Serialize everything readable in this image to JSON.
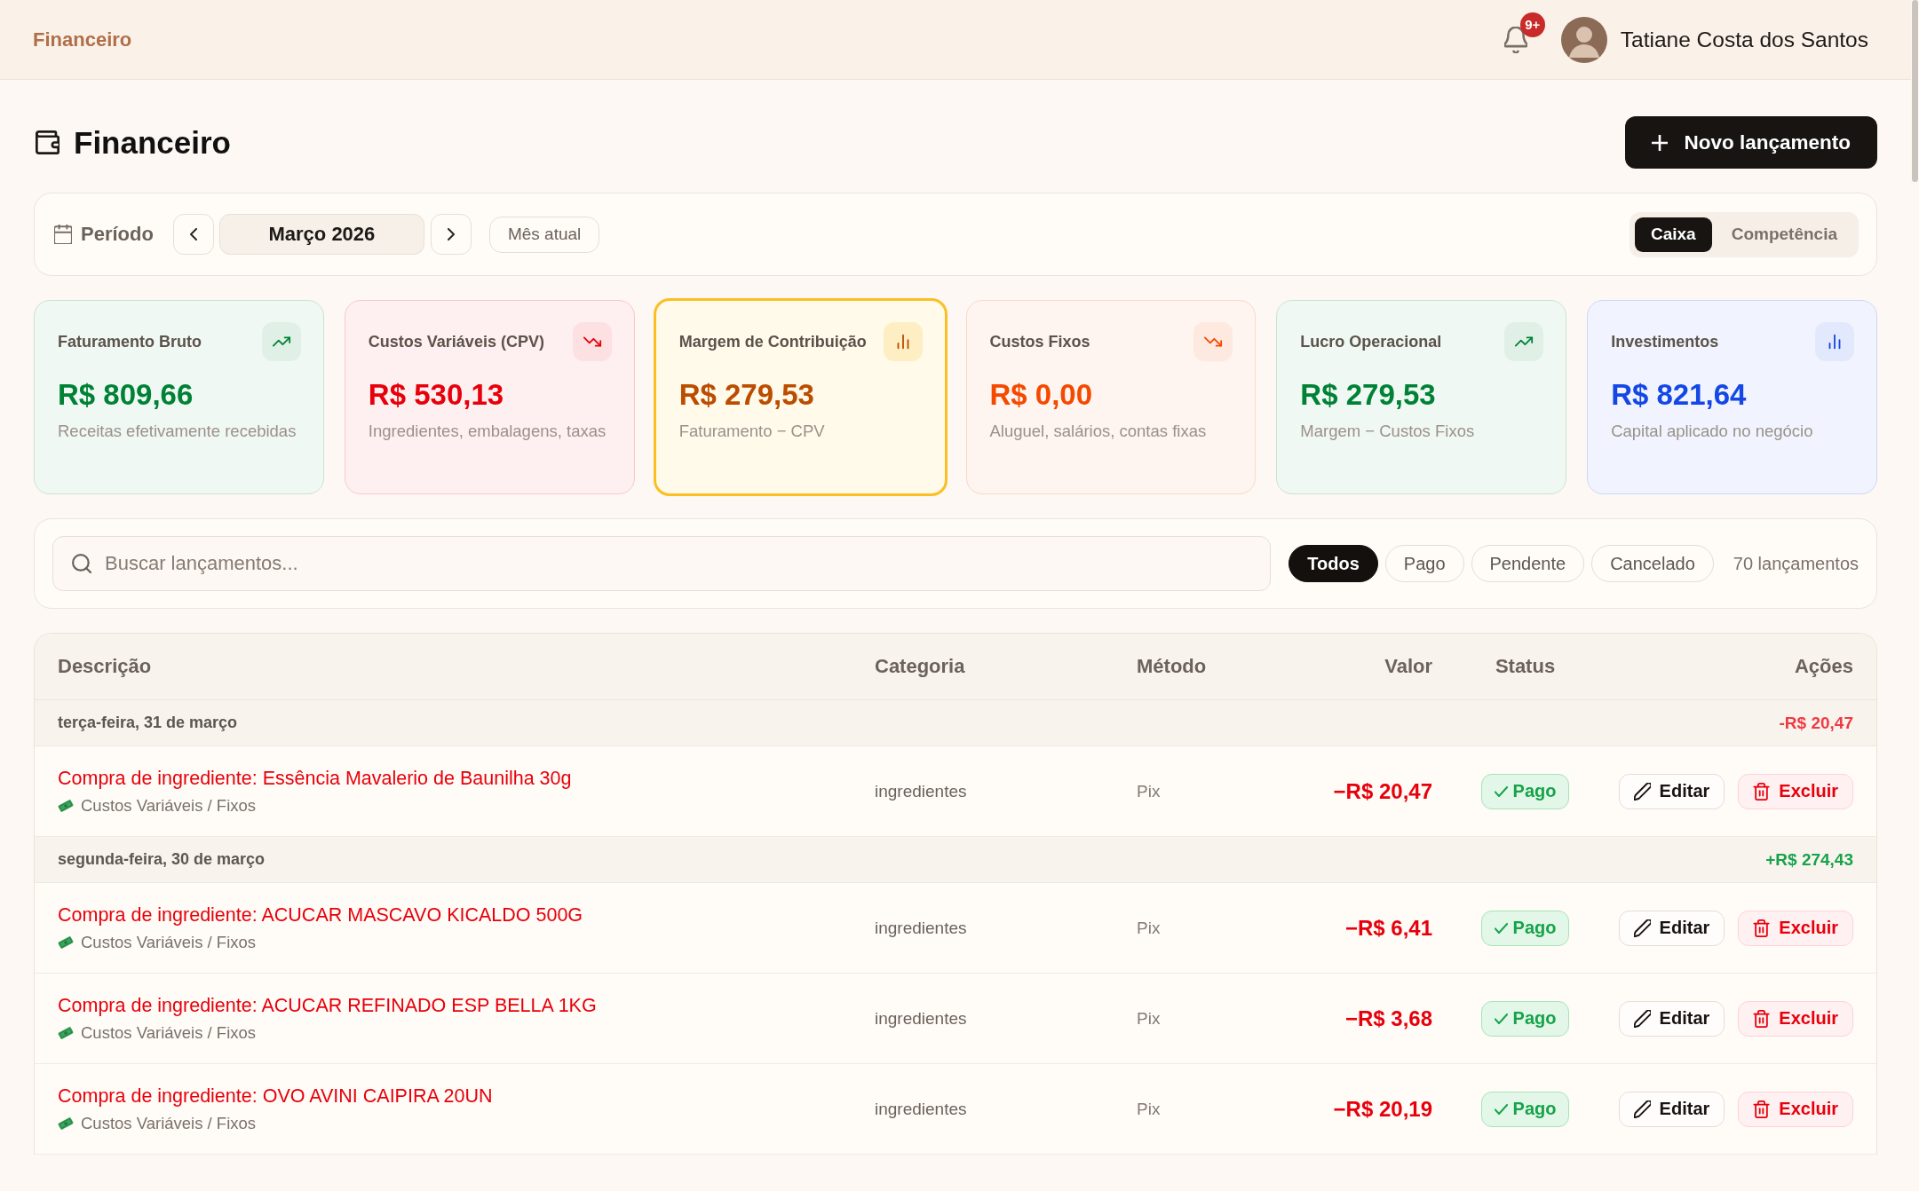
{
  "topbar": {
    "title": "Financeiro",
    "notification_badge": "9+",
    "user_name": "Tatiane Costa dos Santos"
  },
  "header": {
    "title": "Financeiro",
    "new_entry_button": "Novo lançamento"
  },
  "period": {
    "label": "Período",
    "month": "Março 2026",
    "current_month_button": "Mês atual",
    "modes": [
      {
        "label": "Caixa",
        "selected": true
      },
      {
        "label": "Competência",
        "selected": false
      }
    ]
  },
  "summary_cards": [
    {
      "title": "Faturamento Bruto",
      "value": "R$ 809,66",
      "note": "Receitas efetivamente recebidas",
      "kind": "rising",
      "color": "#008236",
      "highlighted": false
    },
    {
      "title": "Custos Variáveis (CPV)",
      "value": "R$ 530,13",
      "note": "Ingredientes, embalagens, taxas",
      "kind": "falling",
      "color": "#e7000b",
      "highlighted": false
    },
    {
      "title": "Margem de Contribuição",
      "value": "R$ 279,53",
      "note": "Faturamento − CPV",
      "kind": "bars",
      "color": "#bb4d00",
      "highlighted": true
    },
    {
      "title": "Custos Fixos",
      "value": "R$ 0,00",
      "note": "Aluguel, salários, contas fixas",
      "kind": "falling",
      "color": "#f54900",
      "highlighted": false
    },
    {
      "title": "Lucro Operacional",
      "value": "R$ 279,53",
      "note": "Margem − Custos Fixos",
      "kind": "rising",
      "color": "#008236",
      "highlighted": false
    },
    {
      "title": "Investimentos",
      "value": "R$ 821,64",
      "note": "Capital aplicado no negócio",
      "kind": "bars",
      "color": "#1447e6",
      "highlighted": false
    }
  ],
  "filters": {
    "search": {
      "placeholder": "Buscar lançamentos..."
    },
    "statuses": [
      {
        "label": "Todos",
        "selected": true
      },
      {
        "label": "Pago",
        "selected": false
      },
      {
        "label": "Pendente",
        "selected": false
      },
      {
        "label": "Cancelado",
        "selected": false
      }
    ],
    "count": "70 lançamentos"
  },
  "table": {
    "columns": [
      "Descrição",
      "Categoria",
      "Método",
      "Valor",
      "Status",
      "Ações"
    ],
    "groups": [
      {
        "date": "terça-feira, 31 de março",
        "total": "-R$ 20,47",
        "kind": "expense",
        "rows": [
          {
            "description": "Compra de ingrediente: Essência Mavalerio de Baunilha 30g",
            "kind": "expense",
            "subcategory": "Custos Variáveis / Fixos",
            "category": "ingredientes",
            "method": "Pix",
            "value": "−R$ 20,47",
            "status": {
              "label": "Pago",
              "kind": "paid"
            },
            "actions": [
              {
                "label": "Editar",
                "kind": "edit"
              },
              {
                "label": "Excluir",
                "kind": "delete"
              }
            ]
          }
        ]
      },
      {
        "date": "segunda-feira, 30 de março",
        "total": "+R$ 274,43",
        "kind": "income",
        "rows": [
          {
            "description": "Compra de ingrediente: ACUCAR MASCAVO KICALDO 500G",
            "kind": "expense",
            "subcategory": "Custos Variáveis / Fixos",
            "category": "ingredientes",
            "method": "Pix",
            "value": "−R$ 6,41",
            "status": {
              "label": "Pago",
              "kind": "paid"
            },
            "actions": [
              {
                "label": "Editar",
                "kind": "edit"
              },
              {
                "label": "Excluir",
                "kind": "delete"
              }
            ]
          },
          {
            "description": "Compra de ingrediente: ACUCAR REFINADO ESP BELLA 1KG",
            "kind": "expense",
            "subcategory": "Custos Variáveis / Fixos",
            "category": "ingredientes",
            "method": "Pix",
            "value": "−R$ 3,68",
            "status": {
              "label": "Pago",
              "kind": "paid"
            },
            "actions": [
              {
                "label": "Editar",
                "kind": "edit"
              },
              {
                "label": "Excluir",
                "kind": "delete"
              }
            ]
          },
          {
            "description": "Compra de ingrediente: OVO AVINI CAIPIRA 20UN",
            "kind": "expense",
            "subcategory": "Custos Variáveis / Fixos",
            "category": "ingredientes",
            "method": "Pix",
            "value": "−R$ 20,19",
            "status": {
              "label": "Pago",
              "kind": "paid"
            },
            "actions": [
              {
                "label": "Editar",
                "kind": "edit"
              },
              {
                "label": "Excluir",
                "kind": "delete"
              }
            ]
          }
        ]
      }
    ]
  }
}
